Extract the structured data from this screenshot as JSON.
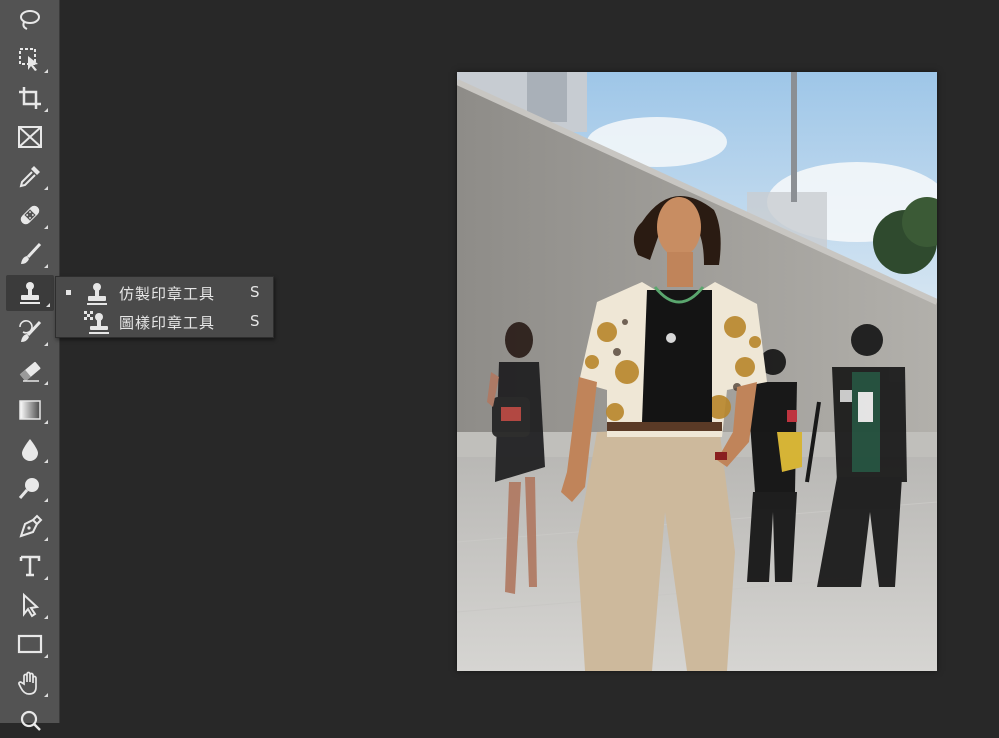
{
  "toolbar": {
    "tools": [
      {
        "name": "lasso-tool",
        "icon": "lasso-icon"
      },
      {
        "name": "object-selection-tool",
        "icon": "object-selection-icon"
      },
      {
        "name": "crop-tool",
        "icon": "crop-icon"
      },
      {
        "name": "frame-tool",
        "icon": "frame-icon"
      },
      {
        "name": "eyedropper-tool",
        "icon": "eyedropper-icon"
      },
      {
        "name": "healing-brush-tool",
        "icon": "bandage-icon"
      },
      {
        "name": "brush-tool",
        "icon": "brush-icon"
      },
      {
        "name": "clone-stamp-tool",
        "icon": "stamp-icon",
        "active": true
      },
      {
        "name": "history-brush-tool",
        "icon": "history-brush-icon"
      },
      {
        "name": "eraser-tool",
        "icon": "eraser-icon"
      },
      {
        "name": "gradient-tool",
        "icon": "gradient-icon"
      },
      {
        "name": "blur-tool",
        "icon": "drop-icon"
      },
      {
        "name": "dodge-tool",
        "icon": "dodge-icon"
      },
      {
        "name": "pen-tool",
        "icon": "pen-icon"
      },
      {
        "name": "type-tool",
        "icon": "type-icon"
      },
      {
        "name": "path-selection-tool",
        "icon": "arrow-icon"
      },
      {
        "name": "rectangle-tool",
        "icon": "rectangle-icon"
      },
      {
        "name": "hand-tool",
        "icon": "hand-icon"
      },
      {
        "name": "zoom-tool",
        "icon": "zoom-icon"
      }
    ]
  },
  "flyout": {
    "items": [
      {
        "label": "仿製印章工具",
        "shortcut": "S",
        "icon": "stamp-icon",
        "selected": true
      },
      {
        "label": "圖樣印章工具",
        "shortcut": "S",
        "icon": "pattern-stamp-icon",
        "selected": false
      }
    ]
  },
  "canvas": {
    "subject": "street-fashion-photo"
  }
}
